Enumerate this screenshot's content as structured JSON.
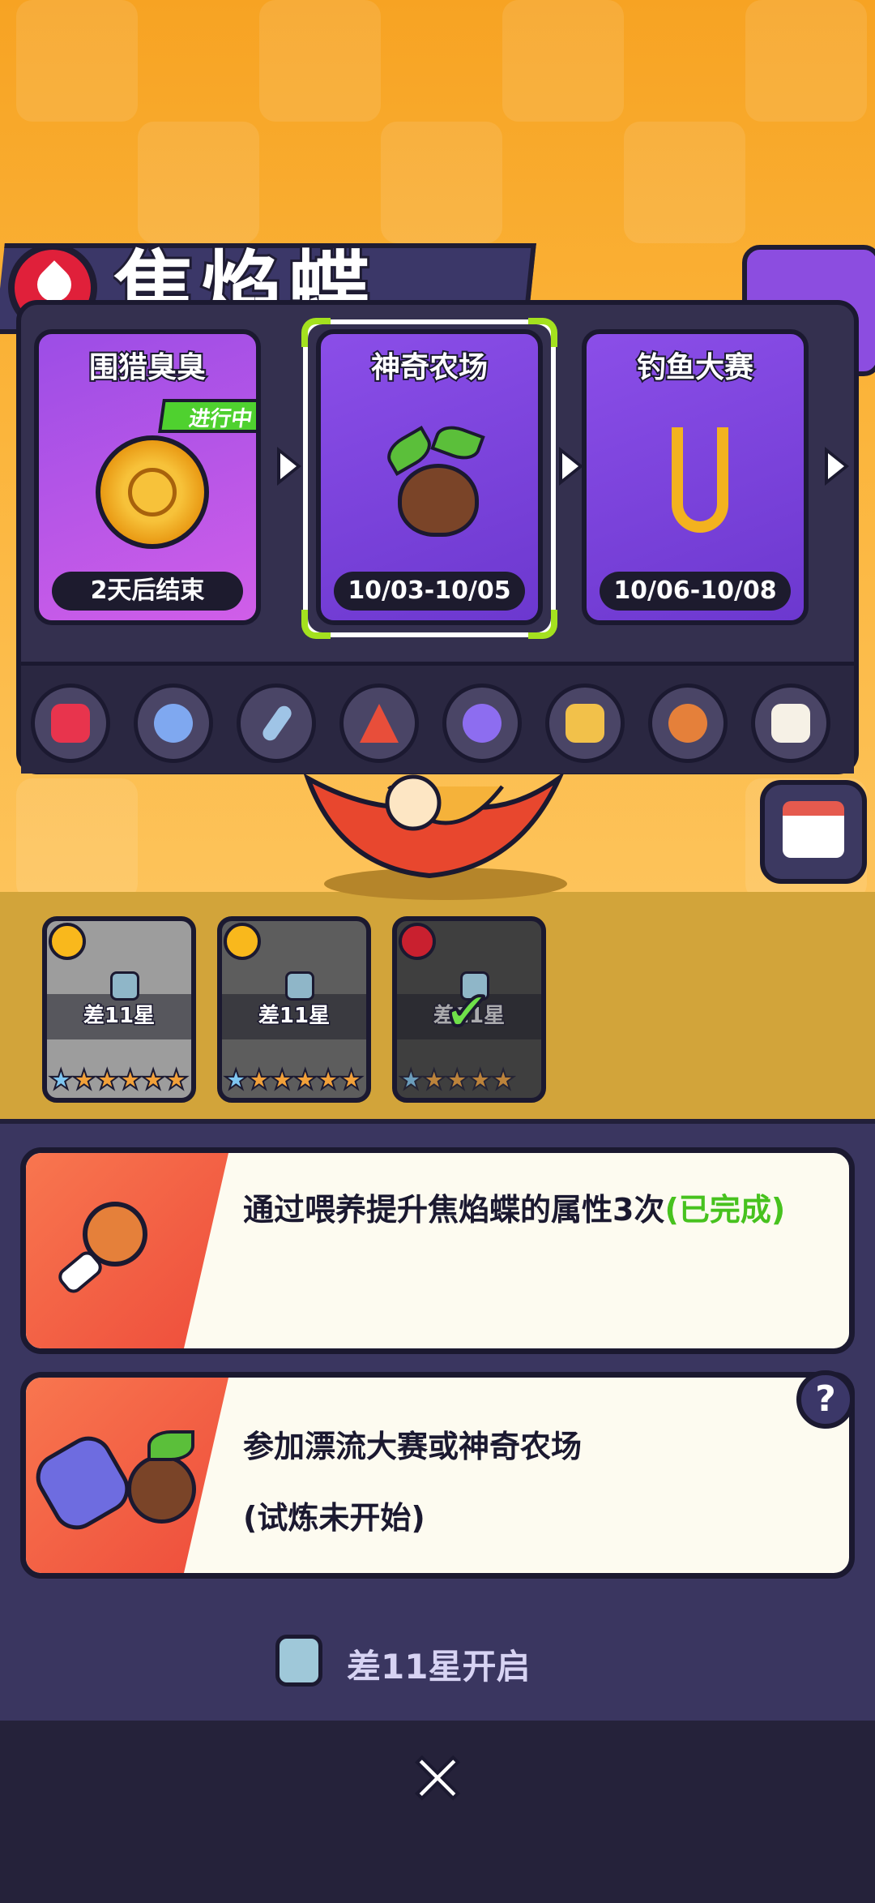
{
  "title": "焦焰蝶",
  "events": [
    {
      "name": "围猎臭臭",
      "status_badge": "进行中",
      "time": "2天后结束",
      "icon": "coin-icon"
    },
    {
      "name": "神奇农场",
      "time": "10/03-10/05",
      "icon": "seed-sprout-icon",
      "selected": true
    },
    {
      "name": "钓鱼大赛",
      "time": "10/06-10/08",
      "icon": "fishing-hook-icon"
    }
  ],
  "shortcut_icons": [
    "energy-drink-icon",
    "lollipop-icon",
    "sword-icon",
    "tent-icon",
    "orb-icon",
    "castle-icon",
    "drumstick-icon",
    "clipboard-check-icon"
  ],
  "pets": [
    {
      "label": "差11星",
      "element": "lightning-icon",
      "stars_filled": 1,
      "stars_total": 6
    },
    {
      "label": "差11星",
      "element": "lightning-icon",
      "stars_filled": 1,
      "stars_total": 6
    },
    {
      "label": "差11星",
      "element": "fire-icon",
      "stars_filled": 1,
      "stars_total": 5,
      "completed": true
    }
  ],
  "tasks": [
    {
      "text": "通过喂养提升焦焰蝶的属性3次",
      "status": "(已完成)",
      "status_color": "#47c21e",
      "icon": "drumstick-icon"
    },
    {
      "text": "参加漂流大赛或神奇农场",
      "status": "(试炼未开始)",
      "status_color": "#f08a35",
      "icon": "raft-and-seed-icon"
    }
  ],
  "help_label": "?",
  "unlock_text": "差11星开启",
  "close_label": "✕",
  "colors": {
    "accent_green": "#47c21e",
    "accent_orange": "#f08a35",
    "panel": "#34304f",
    "background": "#f7a323"
  }
}
